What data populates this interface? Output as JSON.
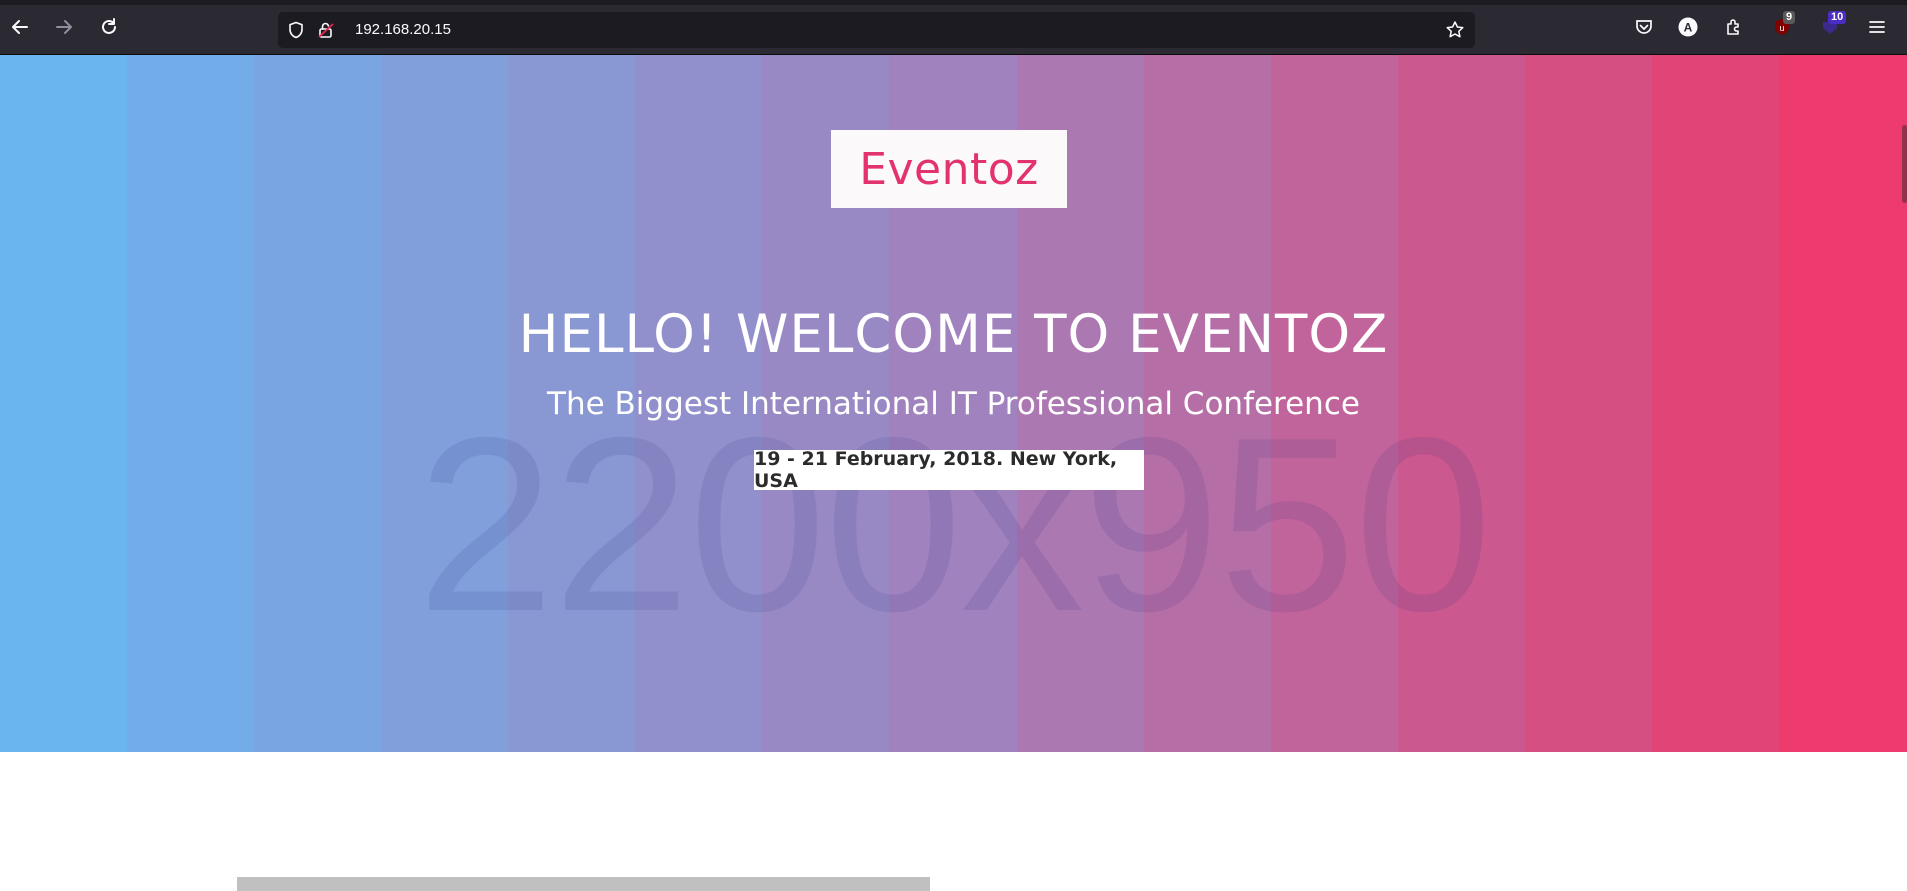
{
  "browser": {
    "url": "192.168.20.15",
    "extension_badges": {
      "ublock_count": "9",
      "other_count": "10"
    },
    "icons": [
      "back-icon",
      "forward-icon",
      "reload-icon",
      "shield-icon",
      "insecure-lock-icon",
      "bookmark-star-icon",
      "pocket-icon",
      "account-icon",
      "extensions-icon",
      "ublock-icon",
      "extension-icon",
      "menu-icon"
    ]
  },
  "page": {
    "logo": "Eventoz",
    "headline": "HELLO! WELCOME TO EVENTOZ",
    "subheadline": "The Biggest International IT Professional Conference",
    "event_date": "19 - 21 February, 2018. New York, USA",
    "placeholder_watermark": "2200x950"
  },
  "colors": {
    "gradient_start": "#6ab4f0",
    "gradient_end": "#ec3b6c",
    "logo_text": "#e3336f",
    "chrome_bg": "#2b2a33",
    "urlbar_bg": "#1c1b22"
  }
}
